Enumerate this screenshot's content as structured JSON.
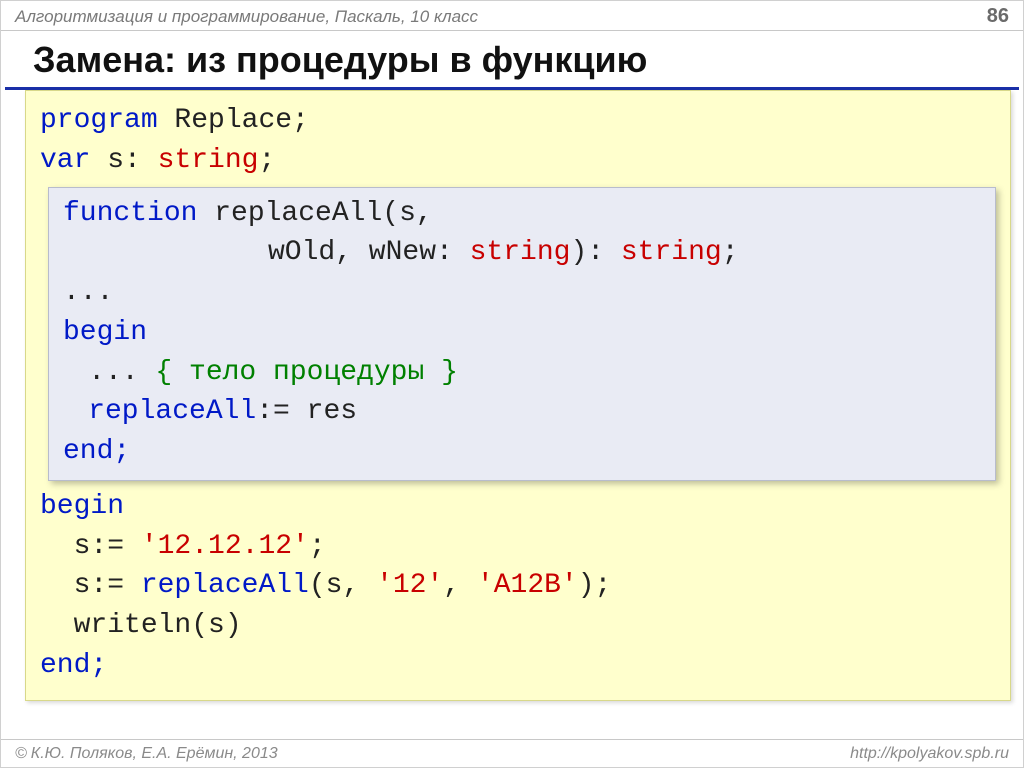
{
  "header": {
    "subject": "Алгоритмизация и программирование, Паскаль, 10 класс",
    "page": "86"
  },
  "title": "Замена: из процедуры в функцию",
  "outer": {
    "l1a": "program",
    "l1b": " Replace;",
    "l2a": "var",
    "l2b": " s: ",
    "l2c": "string",
    "l2d": ";",
    "l9": "begin",
    "l10a": "  s:= ",
    "l10b": "'12.12.12'",
    "l10c": ";",
    "l11a": "  s:= ",
    "l11b": "replaceAll",
    "l11c": "(s, ",
    "l11d": "'12'",
    "l11e": ", ",
    "l11f": "'A12B'",
    "l11g": ");",
    "l12a": "  writeln(s)",
    "l13": "end;"
  },
  "inner": {
    "l1a": "function",
    "l1b": " replaceAll",
    "l1c": "(s,",
    "l2a": "wOld, wNew: ",
    "l2b": "string",
    "l2c": "): ",
    "l2d": "string",
    "l2e": ";",
    "l3": "...",
    "l4": "begin",
    "l5a": "... ",
    "l5b": "{ тело процедуры }",
    "l6a": "replaceAll",
    "l6b": ":= res",
    "l7": "end;"
  },
  "footer": {
    "copyright": "К.Ю. Поляков, Е.А. Ерёмин, 2013",
    "url": "http://kpolyakov.spb.ru",
    "copy_symbol": "©"
  }
}
